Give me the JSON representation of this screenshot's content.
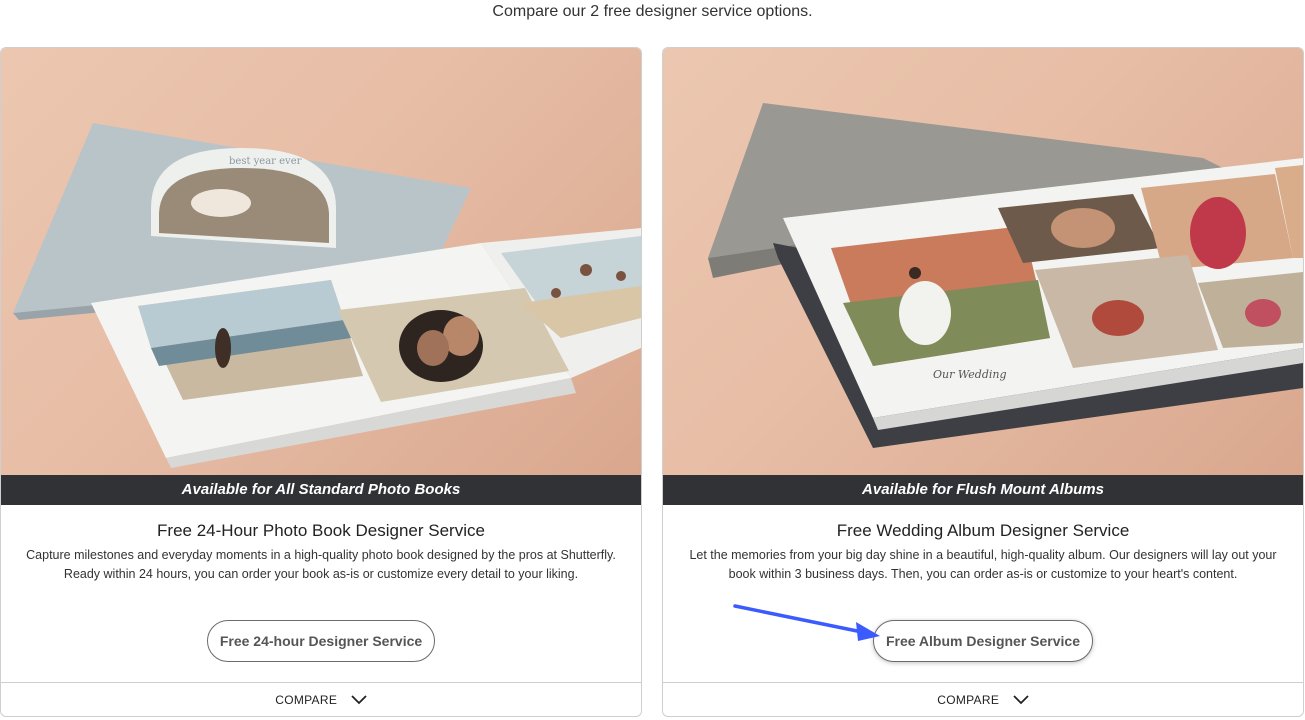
{
  "heading": "Compare our 2 free designer service options.",
  "cards": [
    {
      "banner": "Available for All Standard Photo Books",
      "title": "Free 24-Hour Photo Book Designer Service",
      "description": "Capture milestones and everyday moments in a high-quality photo book designed by the pros at Shutterfly. Ready within 24 hours, you can order your book as-is or customize every detail to your liking.",
      "button_label": "Free 24-hour Designer Service",
      "compare_label": "COMPARE",
      "image_text": "best year ever"
    },
    {
      "banner": "Available for Flush Mount Albums",
      "title": "Free Wedding Album Designer Service",
      "description": "Let the memories from your big day shine in a beautiful, high-quality album. Our designers will lay out your book within 3 business days. Then, you can order as-is or customize to your heart's content.",
      "button_label": "Free Album Designer Service",
      "compare_label": "COMPARE",
      "image_text": "Our Wedding"
    }
  ],
  "colors": {
    "banner_bg": "#303236",
    "annotation_arrow": "#3b5bff",
    "image_bg": "#e7bda6"
  }
}
